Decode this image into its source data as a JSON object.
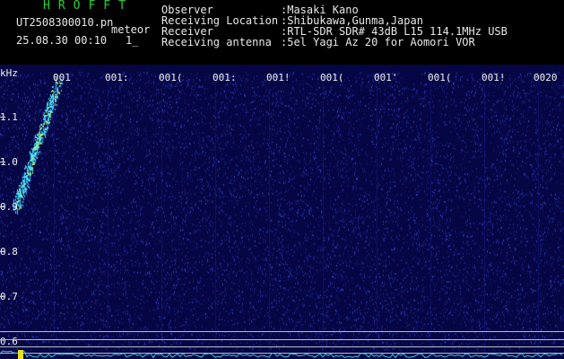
{
  "header": {
    "app_title": "HROFFT",
    "filename": "UT2508300010.pn",
    "object_label": "meteor",
    "timestamp": "25.08.30 00:10",
    "count": "1_",
    "info": [
      {
        "label": "Observer",
        "value": ":Masaki Kano"
      },
      {
        "label": "Receiving Location",
        "value": ":Shibukawa,Gunma,Japan"
      },
      {
        "label": "Receiver",
        "value": ":RTL-SDR SDR# 43dB L15 114.1MHz USB"
      },
      {
        "label": "Receiving antenna",
        "value": ":5el Yagi Az 20 for Aomori VOR"
      }
    ]
  },
  "spectrogram": {
    "y_unit": "kHz",
    "y_ticks": [
      "1.1",
      "1.0",
      "0.9",
      "0.8",
      "0.7",
      "0.6"
    ],
    "time_ticks": [
      "001",
      "001:",
      "001(",
      "001:",
      "001!",
      "001(",
      "001'",
      "001(",
      "001!",
      "0020"
    ],
    "colors": {
      "background": "#060644",
      "noise": "#1f2a9a",
      "echo": "#3fd6ff",
      "echo_core": "#c8f04a"
    }
  }
}
